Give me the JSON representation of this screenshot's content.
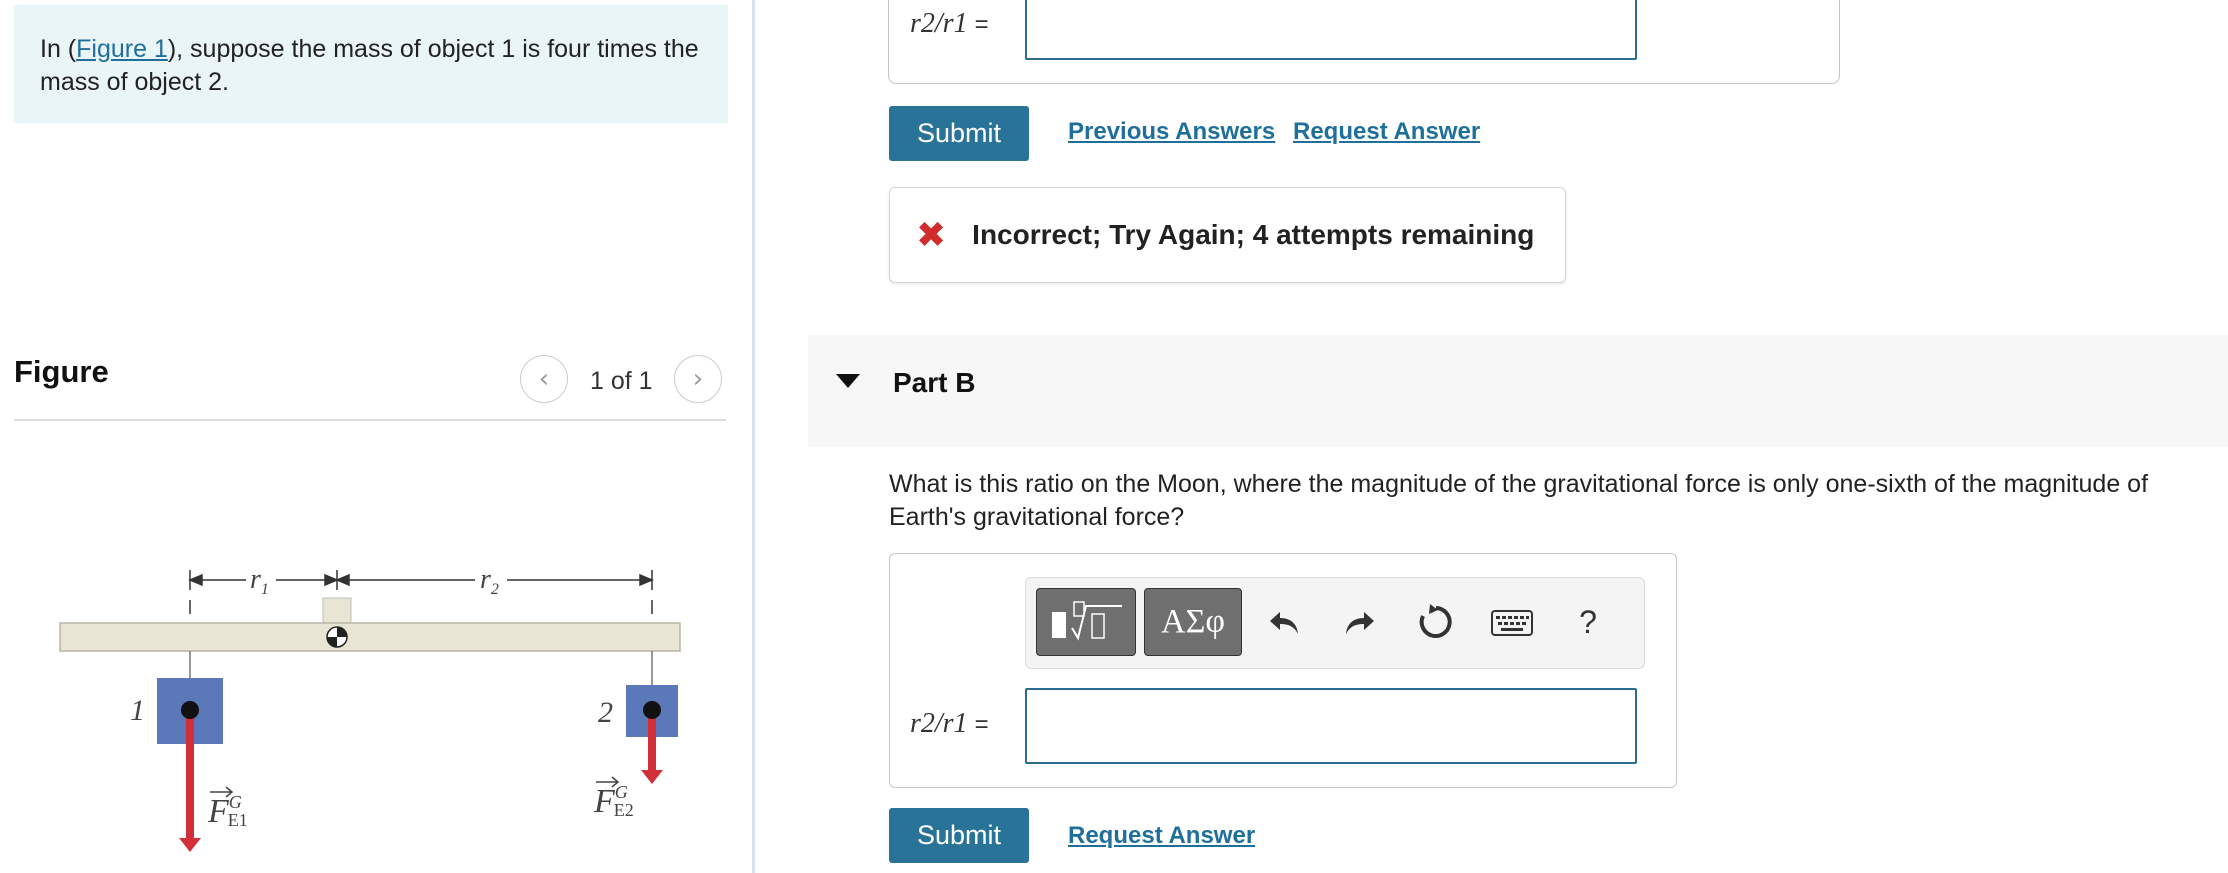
{
  "intro": {
    "prefix": "In (",
    "figure_link": "Figure 1",
    "suffix": "), suppose the mass of object 1 is four times the mass of object 2."
  },
  "figure": {
    "title": "Figure",
    "page_count": "1 of 1",
    "prev_icon": "chevron-left-icon",
    "next_icon": "chevron-right-icon",
    "labels": {
      "r1": "r",
      "r1_sub": "1",
      "r2": "r",
      "r2_sub": "2",
      "object1": "1",
      "object2": "2",
      "force1": "F",
      "force1_sup": "G",
      "force1_sub": "E1",
      "force2": "F",
      "force2_sup": "G",
      "force2_sub": "E2"
    },
    "colors": {
      "beam": "#e8e5d5",
      "block": "#5b78b8",
      "arrow": "#d1303a"
    }
  },
  "part_a": {
    "eq_label": "r2/r1",
    "eq_sign": "=",
    "answer_value": "",
    "submit_label": "Submit",
    "previous_answers_label": "Previous Answers",
    "request_answer_label": "Request Answer",
    "feedback_icon": "x-icon",
    "feedback_message": "Incorrect; Try Again; 4 attempts remaining"
  },
  "part_b": {
    "title": "Part B",
    "question": "What is this ratio on the Moon, where the magnitude of the gravitational force is only one-sixth of the magnitude of Earth's gravitational force?",
    "toolbar": {
      "templates_icon": "templates-icon",
      "symbols_label": "ΑΣφ",
      "undo_icon": "undo-icon",
      "redo_icon": "redo-icon",
      "reset_icon": "reset-icon",
      "keyboard_icon": "keyboard-icon",
      "help_label": "?"
    },
    "eq_label": "r2/r1",
    "eq_sign": "=",
    "answer_value": "",
    "submit_label": "Submit",
    "request_answer_label": "Request Answer"
  },
  "colors": {
    "accent": "#2a7398",
    "link": "#1f6f9c",
    "error": "#d12c2c",
    "intro_bg": "#e9f5f7"
  }
}
